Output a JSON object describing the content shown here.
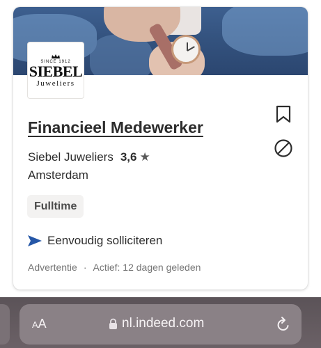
{
  "job": {
    "title": "Financieel Medewerker",
    "company": "Siebel Juweliers",
    "rating": "3,6",
    "rating_star": "★",
    "location": "Amsterdam",
    "job_type": "Fulltime",
    "easy_apply": "Eenvoudig solliciteren",
    "sponsored": "Advertentie",
    "separator": "·",
    "active": "Actief: 12 dagen geleden"
  },
  "logo": {
    "since": "SINCE 1912",
    "brand": "SIEBEL",
    "sub": "Juweliers"
  },
  "icons": {
    "save": "bookmark-icon",
    "not_interested": "block-icon",
    "apply": "send-arrow-icon",
    "lock": "lock-icon",
    "reload": "reload-icon"
  },
  "browser": {
    "text_size_large": "A",
    "text_size_small": "A",
    "url": "nl.indeed.com"
  },
  "colors": {
    "accent": "#2557a7",
    "text": "#2d2d2d",
    "muted": "#767676",
    "badge_bg": "#f3f2f1"
  }
}
